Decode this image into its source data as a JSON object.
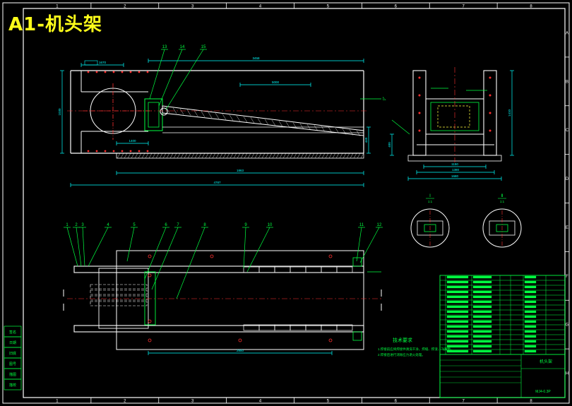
{
  "title": "A1-机头架",
  "colors": {
    "background": "#000000",
    "frame": "#ffffff",
    "outline": "#ffffff",
    "centerline": "#ff3030",
    "dimension": "#00ffff",
    "leader": "#00ff40",
    "hidden": "#ffff40",
    "title_text": "#ffff1a",
    "hatch": "#ffffff"
  },
  "grid": {
    "columns": [
      "1",
      "2",
      "3",
      "4",
      "5",
      "6",
      "7",
      "8"
    ],
    "rows": [
      "A",
      "B",
      "C",
      "D",
      "E",
      "F",
      "G",
      "H"
    ]
  },
  "side_view": {
    "dims": {
      "top_length": "3458",
      "short_a": "1410",
      "left_len": "1670",
      "mid_len": "1400",
      "total": "4787",
      "height": "1030",
      "slope_len": "5000",
      "right_h": "440",
      "bottom_r": "1863"
    },
    "balloons": [
      "13",
      "14",
      "15"
    ]
  },
  "end_view": {
    "dims": {
      "width_a": "1150",
      "width_b": "1380",
      "width_c": "1680",
      "height": "1410",
      "side": "400"
    }
  },
  "plan_view": {
    "balloons": [
      "1",
      "2",
      "3",
      "4",
      "5",
      "6",
      "7",
      "8",
      "9",
      "10",
      "11",
      "12"
    ],
    "dims": {
      "bottom": "2850"
    }
  },
  "details": [
    {
      "label": "Ⅰ",
      "scale": "1:1"
    },
    {
      "label": "Ⅱ",
      "scale": "1:1"
    }
  ],
  "technical_requirements": {
    "heading": "技术要求",
    "lines": [
      "1.焊接前应将焊接件清洗干净，焊缝、焊渣、飞溅物。",
      "2.焊接后进行消除应力退火处理。"
    ]
  },
  "title_block": {
    "drawing_no": "MJ4-0.3P",
    "name": "机头架",
    "rows": 16
  },
  "left_panel": {
    "cells": [
      "签名",
      "日期",
      "旧底",
      "图号",
      "描图",
      "描校"
    ]
  }
}
